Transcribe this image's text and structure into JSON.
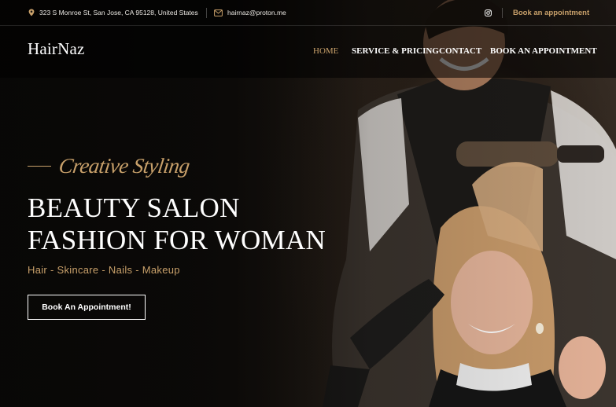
{
  "topbar": {
    "address": "323 S Monroe St, San Jose, CA 95128, United States",
    "email": "hairnaz@proton.me",
    "social_icon": "instagram-icon",
    "book_link": "Book an appointment"
  },
  "header": {
    "logo": "HairNaz",
    "nav": [
      {
        "label": "HOME",
        "active": true
      },
      {
        "label": "SERVICE & PRICING",
        "active": false
      },
      {
        "label": "CONTACT",
        "active": false
      },
      {
        "label": "BOOK AN APPOINTMENT",
        "active": false
      }
    ]
  },
  "hero": {
    "tagline": "Creative Styling",
    "title_line1": "BEAUTY SALON",
    "title_line2": "FASHION FOR WOMAN",
    "subtitle": "Hair - Skincare - Nails - Makeup",
    "cta": "Book An Appointment!",
    "image": "hairdresser-styling-woman-hair-photo"
  },
  "colors": {
    "accent": "#c8a06a",
    "background": "#0e0c0a",
    "text": "#ffffff"
  }
}
